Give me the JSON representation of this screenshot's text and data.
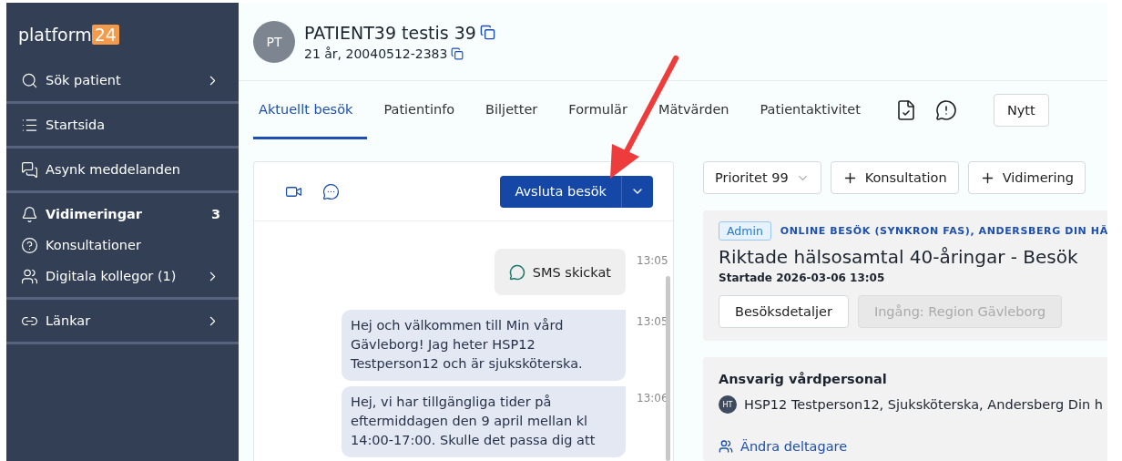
{
  "sidebar": {
    "logo": {
      "text": "platform",
      "badge": "24"
    },
    "groups": [
      [
        {
          "label": "Sök patient",
          "has_submenu": true
        }
      ],
      [
        {
          "label": "Startsida",
          "has_submenu": false
        }
      ],
      [
        {
          "label": "Asynk meddelanden",
          "has_submenu": false
        }
      ],
      [
        {
          "label": "Vidimeringar",
          "has_submenu": false,
          "count": "3"
        },
        {
          "label": "Konsultationer",
          "has_submenu": false
        },
        {
          "label": "Digitala kollegor (1)",
          "has_submenu": true
        }
      ],
      [
        {
          "label": "Länkar",
          "has_submenu": true
        }
      ]
    ]
  },
  "patient": {
    "initials": "PT",
    "name": "PATIENT39 testis 39",
    "details": "21 år, 20040512-2383"
  },
  "tabs": [
    {
      "label": "Aktuellt besök",
      "selected": true
    },
    {
      "label": "Patientinfo",
      "selected": false
    },
    {
      "label": "Biljetter",
      "selected": false
    },
    {
      "label": "Formulär",
      "selected": false
    },
    {
      "label": "Mätvärden",
      "selected": false
    },
    {
      "label": "Patientaktivitet",
      "selected": false
    }
  ],
  "new_button": "Nytt",
  "chat": {
    "end_button": "Avsluta besök",
    "messages": [
      {
        "kind": "event",
        "text": "SMS skickat",
        "time": "13:05"
      },
      {
        "kind": "message",
        "text": "Hej och välkommen till Min vård Gävleborg! Jag heter HSP12 Testperson12 och är sjuksköterska.",
        "time": "13:05"
      },
      {
        "kind": "message",
        "text": "Hej, vi har tillgängliga tider på eftermiddagen den 9 april mellan kl 14:00-17:00. Skulle det passa dig att",
        "time": "13:06"
      }
    ]
  },
  "actions": {
    "priority": "Prioritet 99",
    "add_buttons": [
      "Konsultation",
      "Vidimering"
    ]
  },
  "visit": {
    "tag": "Admin",
    "type": "ONLINE BESÖK (SYNKRON FAS), ANDERSBERG DIN HÄ",
    "title": "Riktade hälsosamtal 40-åringar - Besök",
    "started": "Startade 2026-03-06 13:05",
    "buttons": [
      {
        "label": "Besöksdetaljer",
        "disabled": false
      },
      {
        "label": "Ingång: Region Gävleborg",
        "disabled": true
      }
    ]
  },
  "staff": {
    "heading": "Ansvarig vårdpersonal",
    "initials": "HT",
    "person": "HSP12 Testperson12, Sjuksköterska, Andersberg Din h",
    "link": "Ändra deltagare"
  }
}
